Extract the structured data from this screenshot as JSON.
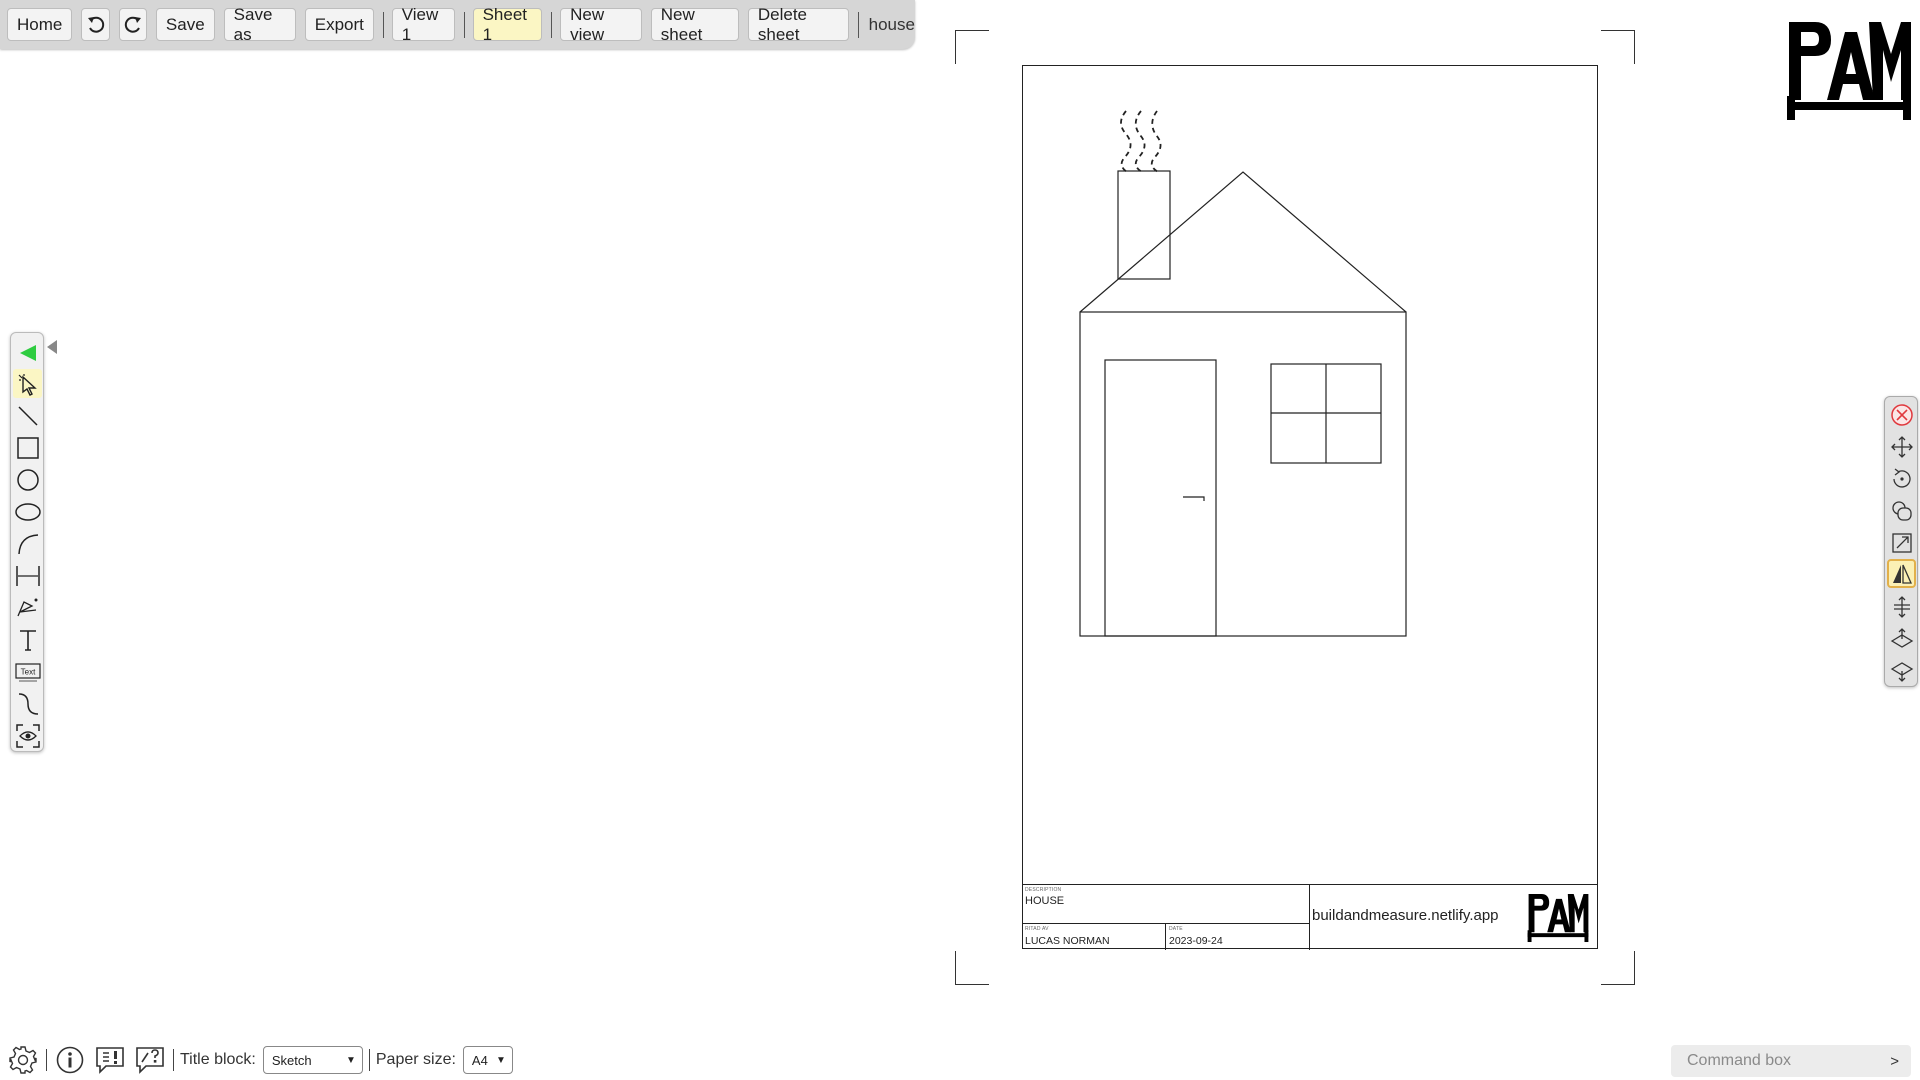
{
  "toolbar": {
    "home_label": "Home",
    "undo_icon": "undo-icon",
    "redo_icon": "redo-icon",
    "save_label": "Save",
    "save_as_label": "Save as",
    "export_label": "Export",
    "view_label": "View 1",
    "sheet_label": "Sheet 1",
    "new_view_label": "New view",
    "new_sheet_label": "New sheet",
    "delete_sheet_label": "Delete sheet",
    "project_name": "house"
  },
  "left_tools": [
    {
      "name": "collapse-toolbar-icon"
    },
    {
      "name": "select-pointer-icon",
      "active": true
    },
    {
      "name": "line-tool-icon"
    },
    {
      "name": "rectangle-tool-icon"
    },
    {
      "name": "circle-tool-icon"
    },
    {
      "name": "ellipse-tool-icon"
    },
    {
      "name": "arc-tool-icon"
    },
    {
      "name": "dimension-tool-icon"
    },
    {
      "name": "polyline-tool-icon"
    },
    {
      "name": "text-tool-icon"
    },
    {
      "name": "text-box-tool-icon"
    },
    {
      "name": "spline-tool-icon"
    },
    {
      "name": "view-frame-tool-icon"
    }
  ],
  "right_tools": [
    {
      "name": "delete-icon"
    },
    {
      "name": "move-icon"
    },
    {
      "name": "rotate-icon"
    },
    {
      "name": "copy-icon"
    },
    {
      "name": "scale-icon"
    },
    {
      "name": "mirror-icon",
      "active": true
    },
    {
      "name": "offset-icon"
    },
    {
      "name": "bring-forward-icon"
    },
    {
      "name": "send-backward-icon"
    }
  ],
  "title_block": {
    "description_caption": "DESCRIPTION",
    "description": "HOUSE",
    "drawn_by_caption": "RITAD AV",
    "drawn_by": "LUCAS NORMAN",
    "date_caption": "DATE",
    "date": "2023-09-24",
    "website": "buildandmeasure.netlify.app"
  },
  "bottom": {
    "settings_icon": "gear-icon",
    "info_icon": "info-icon",
    "report_icon": "report-issue-icon",
    "help_icon": "help-chat-icon",
    "title_block_label": "Title block:",
    "title_block_value": "Sketch",
    "paper_size_label": "Paper size:",
    "paper_size_value": "A4",
    "command_placeholder": "Command box",
    "command_submit": ">"
  },
  "colors": {
    "toolbar_bg": "#d6d6d6",
    "active_highlight": "#fbf6c4",
    "select_arrow_green": "#2ecc40",
    "delete_red": "#e0393e"
  }
}
